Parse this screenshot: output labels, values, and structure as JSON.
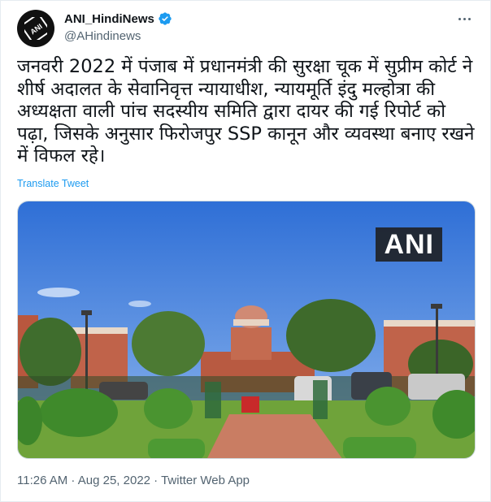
{
  "author": {
    "display_name": "ANI_HindiNews",
    "handle": "@AHindinews",
    "avatar_logo_text": "ANI",
    "verified_icon": "verified-badge-icon"
  },
  "tweet": {
    "text": "जनवरी 2022 में पंजाब में प्रधानमंत्री की सुरक्षा चूक में सुप्रीम कोर्ट ने शीर्ष अदालत के सेवानिवृत्त न्यायाधीश, न्यायमूर्ति इंदु मल्होत्रा की अध्यक्षता वाली पांच सदस्यीय समिति द्वारा दायर की गई रिपोर्ट को पढ़ा, जिसके अनुसार फिरोजपुर SSP कानून और व्यवस्था बनाए रखने में विफल रहे।",
    "translate_label": "Translate Tweet",
    "image_watermark": "ANI",
    "timestamp": "11:26 AM · Aug 25, 2022 · Twitter Web App"
  },
  "colors": {
    "accent": "#1d9bf0",
    "secondary_text": "#536471",
    "primary_text": "#0f1419"
  }
}
